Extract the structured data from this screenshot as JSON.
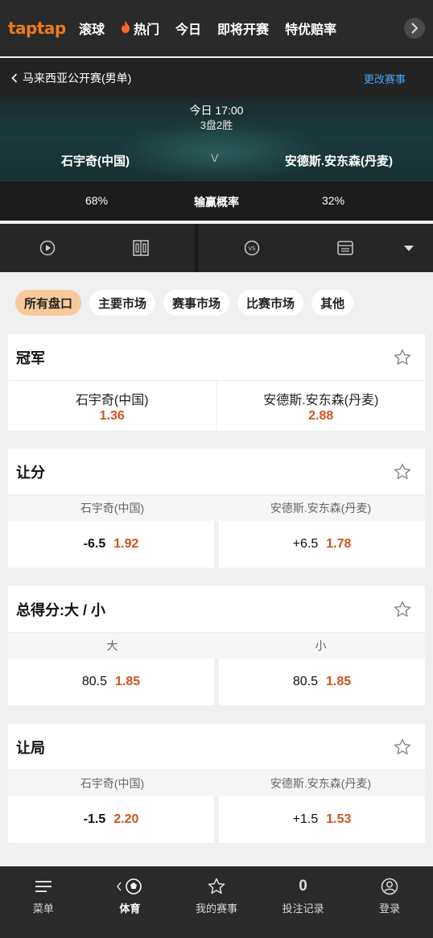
{
  "nav": {
    "logo": "taptap",
    "tabs": [
      {
        "label": "滚球"
      },
      {
        "label": "热门"
      },
      {
        "label": "今日"
      },
      {
        "label": "即将开赛"
      },
      {
        "label": "特优赔率"
      }
    ]
  },
  "breadcrumb": {
    "title": "马来西亚公开赛(男单)",
    "change_label": "更改赛事"
  },
  "match": {
    "time": "今日 17:00",
    "format": "3盘2胜",
    "player1": "石宇奇(中国)",
    "vs": "V",
    "player2": "安德斯.安东森(丹麦)"
  },
  "win_prob": {
    "label": "输赢概率",
    "player1": "68%",
    "player2": "32%"
  },
  "filters": [
    {
      "label": "所有盘口",
      "active": true
    },
    {
      "label": "主要市场",
      "active": false
    },
    {
      "label": "赛事市场",
      "active": false
    },
    {
      "label": "比赛市场",
      "active": false
    },
    {
      "label": "其他",
      "active": false
    }
  ],
  "markets": {
    "winner": {
      "title": "冠军",
      "left": {
        "name": "石宇奇(中国)",
        "odd": "1.36"
      },
      "right": {
        "name": "安德斯.安东森(丹麦)",
        "odd": "2.88"
      }
    },
    "handicap": {
      "title": "让分",
      "left_head": "石宇奇(中国)",
      "right_head": "安德斯.安东森(丹麦)",
      "left": {
        "line": "-6.5",
        "odd": "1.92"
      },
      "right": {
        "line": "+6.5",
        "odd": "1.78"
      }
    },
    "total": {
      "title": "总得分:大 / 小",
      "left_head": "大",
      "right_head": "小",
      "left": {
        "line": "80.5",
        "odd": "1.85"
      },
      "right": {
        "line": "80.5",
        "odd": "1.85"
      }
    },
    "game_handicap": {
      "title": "让局",
      "left_head": "石宇奇(中国)",
      "right_head": "安德斯.安东森(丹麦)",
      "left": {
        "line": "-1.5",
        "odd": "2.20"
      },
      "right": {
        "line": "+1.5",
        "odd": "1.53"
      }
    }
  },
  "bottom": {
    "menu": "菜单",
    "sports": "体育",
    "my_events": "我的赛事",
    "bet_count": "0",
    "bet_records": "投注记录",
    "login": "登录"
  },
  "colors": {
    "accent": "#f07a1a",
    "odds": "#d0541c",
    "link": "#4aa3f0",
    "active_pill": "#f8c99a"
  },
  "icons": [
    "fire-icon",
    "chevron-right-icon",
    "chevron-left-icon",
    "play-icon",
    "scoreboard-icon",
    "vs-icon",
    "stats-icon",
    "caret-down-icon",
    "star-icon",
    "menu-icon",
    "soccer-ball-icon",
    "user-icon"
  ]
}
